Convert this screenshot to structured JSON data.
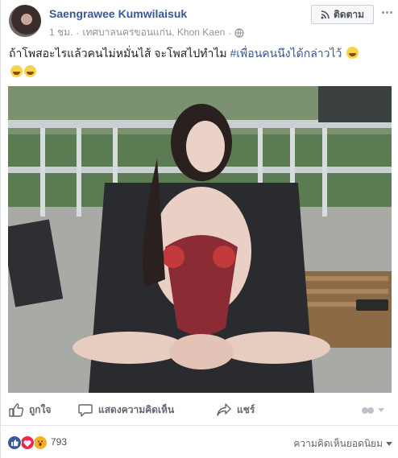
{
  "post": {
    "author_name": "Saengrawee Kumwilaisuk",
    "timestamp": "1 ชม.",
    "location": "เทศบาลนครขอนแก่น, Khon Kaen",
    "follow_label": "ติดตาม",
    "text_main": "ถ้าโพสอะไรแล้วคนไม่หมั่นไส้ จะโพสไปทำไม ",
    "hashtag": "#เพื่อนคนนึงได้กล่าวไว้",
    "emoji_icon": "grinning-squint-emoji",
    "photo_icon": "photo"
  },
  "actions": {
    "like_label": "ถูกใจ",
    "comment_label": "แสดงความคิดเห็น",
    "share_label": "แชร์"
  },
  "footer": {
    "reaction_count": "793",
    "sort_label": "ความคิดเห็นยอดนิยม"
  },
  "colors": {
    "link_blue": "#365899",
    "like_blue": "#3b5998",
    "love_red": "#f0284a",
    "wow_yellow": "#f7b125",
    "muted_text": "#606770"
  }
}
